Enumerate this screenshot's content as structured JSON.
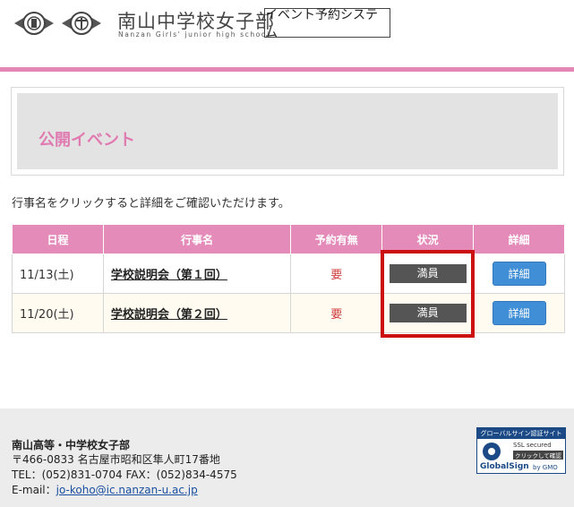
{
  "header": {
    "school_name": "南山中学校女子部",
    "school_sub": "Nanzan Girls' junior high school",
    "system_name": "イベント予約システム"
  },
  "main": {
    "title": "公開イベント",
    "intro": "行事名をクリックすると詳細をご確認いただけます。"
  },
  "table": {
    "headers": [
      "日程",
      "行事名",
      "予約有無",
      "状況",
      "詳細"
    ],
    "rows": [
      {
        "date": "11/13(土)",
        "name": "学校説明会（第１回）",
        "reservation": "要",
        "status": "満員",
        "detail": "詳細"
      },
      {
        "date": "11/20(土)",
        "name": "学校説明会（第２回）",
        "reservation": "要",
        "status": "満員",
        "detail": "詳細"
      }
    ]
  },
  "footer": {
    "name": "南山高等・中学校女子部",
    "address": "〒466-0833 名古屋市昭和区隼人町17番地",
    "tel": "TEL：(052)831-0704 FAX：(052)834-4575",
    "email_label": "E-mail：",
    "email": "jo-koho@ic.nanzan-u.ac.jp"
  },
  "badge": {
    "top": "グローバルサイン認証サイト",
    "ssl": "SSL secured",
    "click": "クリックして確認",
    "brand": "GlobalSign",
    "gmo": "by GMO"
  },
  "colors": {
    "accent_pink": "#e48bb9",
    "title_pink": "#e07ab0",
    "detail_blue": "#3f8ed6",
    "status_gray": "#555555",
    "highlight_red": "#cc1010"
  }
}
